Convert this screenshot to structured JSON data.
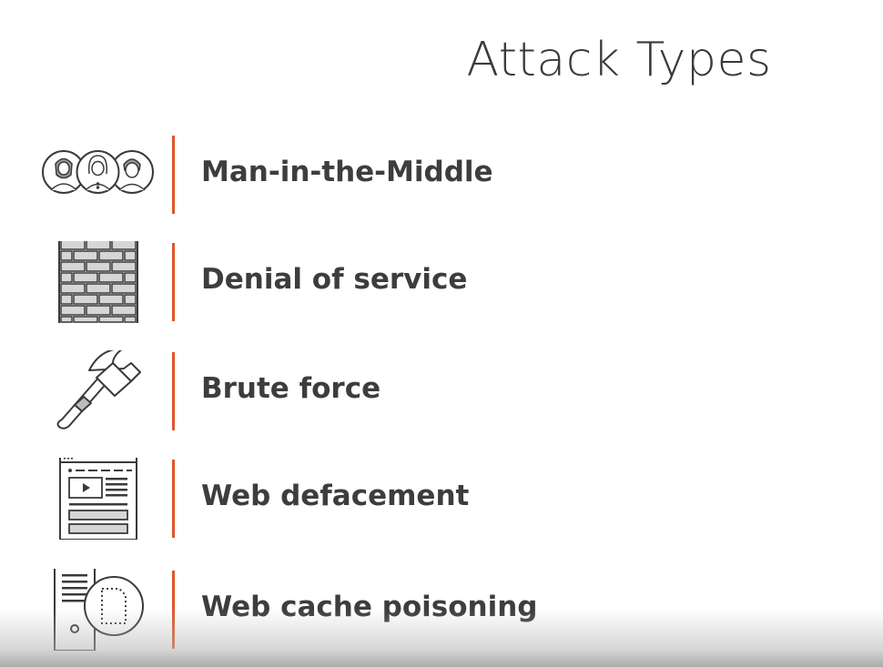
{
  "slide": {
    "title": "Attack Types",
    "accent_color": "#e0562b",
    "items": [
      {
        "label": "Man-in-the-Middle",
        "icon": "people-group-icon"
      },
      {
        "label": "Denial of service",
        "icon": "brick-wall-icon"
      },
      {
        "label": "Brute force",
        "icon": "hammer-icon"
      },
      {
        "label": "Web defacement",
        "icon": "web-page-icon"
      },
      {
        "label": "Web cache poisoning",
        "icon": "server-document-icon"
      }
    ]
  }
}
